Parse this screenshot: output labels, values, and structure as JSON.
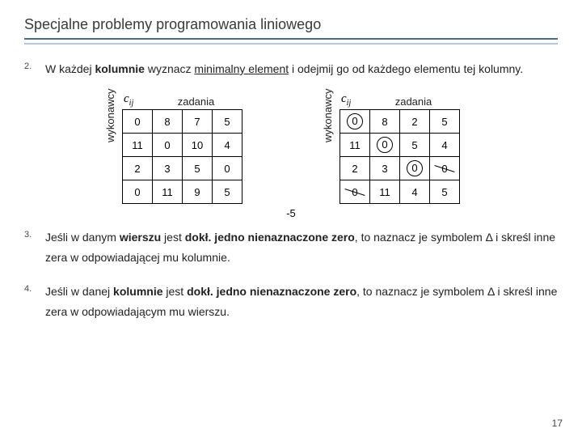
{
  "title": "Specjalne problemy programowania liniowego",
  "items": {
    "n2": "2.",
    "t2a": "W każdej ",
    "t2b": "kolumnie",
    "t2c": " wyznacz ",
    "t2d": "minimalny element",
    "t2e": " i odejmij go od każdego elementu tej kolumny.",
    "n3": "3.",
    "t3a": "Jeśli w danym ",
    "t3b": "wierszu",
    "t3c": " jest ",
    "t3d": "dokł. jedno nienaznaczone zero",
    "t3e": ", to naznacz je symbolem Δ i skreśl inne zera w odpowiadającej mu kolumnie.",
    "n4": "4.",
    "t4a": "Jeśli w danej ",
    "t4b": "kolumnie",
    "t4c": " jest ",
    "t4d": "dokł. jedno nienaznaczone zero",
    "t4e": ", to naznacz je symbolem Δ i skreśl inne zera w odpowiadającym mu wierszu."
  },
  "labels": {
    "cij": "c",
    "cij_sub": "ij",
    "zadania": "zadania",
    "wykonawcy": "wykonawcy",
    "minus5": "-5"
  },
  "left_table": [
    [
      "0",
      "8",
      "7",
      "5"
    ],
    [
      "11",
      "0",
      "10",
      "4"
    ],
    [
      "2",
      "3",
      "5",
      "0"
    ],
    [
      "0",
      "11",
      "9",
      "5"
    ]
  ],
  "right_table": [
    [
      {
        "v": "0",
        "mark": "circ"
      },
      {
        "v": "8"
      },
      {
        "v": "2"
      },
      {
        "v": "5"
      }
    ],
    [
      {
        "v": "11"
      },
      {
        "v": "0",
        "mark": "circ"
      },
      {
        "v": "5"
      },
      {
        "v": "4"
      }
    ],
    [
      {
        "v": "2"
      },
      {
        "v": "3"
      },
      {
        "v": "0",
        "mark": "circ"
      },
      {
        "v": "0",
        "mark": "slash"
      }
    ],
    [
      {
        "v": "0",
        "mark": "slash"
      },
      {
        "v": "11"
      },
      {
        "v": "4"
      },
      {
        "v": "5"
      }
    ]
  ],
  "page_number": "17"
}
